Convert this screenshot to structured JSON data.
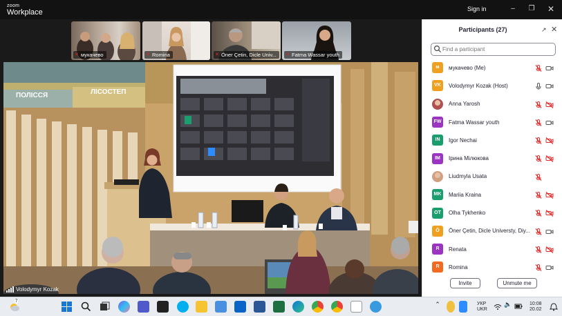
{
  "titlebar": {
    "logo_top": "zoom",
    "logo_bottom": "Workplace",
    "signin_label": "Sign in"
  },
  "thumbnails": [
    {
      "name": "мукачево"
    },
    {
      "name": "Romina"
    },
    {
      "name": "Öner Çetin, Dicle Univ..."
    },
    {
      "name": "Fatma Wassar youth"
    }
  ],
  "main_video": {
    "speaker_name": "Volodymyr Kozak",
    "wall_labels": [
      "ПОЛІССЯ",
      "ЛІСОСТЕП"
    ]
  },
  "panel": {
    "title": "Participants (27)",
    "search_placeholder": "Find a participant",
    "participants": [
      {
        "name": "мукачево (Me)",
        "initials": "м",
        "color": "#f0a020",
        "mic": "off",
        "video": "on",
        "avatar": "initials"
      },
      {
        "name": "Volodymyr Kozak (Host)",
        "initials": "VK",
        "color": "#f0a020",
        "mic": "on",
        "video": "on",
        "avatar": "initials"
      },
      {
        "name": "Anna Yarosh",
        "initials": "",
        "color": "#b05050",
        "mic": "off",
        "video": "off",
        "avatar": "photo"
      },
      {
        "name": "Fatma Wassar youth",
        "initials": "FW",
        "color": "#9b34c0",
        "mic": "off",
        "video": "on",
        "avatar": "initials"
      },
      {
        "name": "Igor Nechai",
        "initials": "IN",
        "color": "#1a9e6e",
        "mic": "off",
        "video": "off",
        "avatar": "initials"
      },
      {
        "name": "Ірина Мілюкова",
        "initials": "ІМ",
        "color": "#9b34c0",
        "mic": "off",
        "video": "off",
        "avatar": "initials"
      },
      {
        "name": "Liudmyla Usata",
        "initials": "",
        "color": "#d0a080",
        "mic": "off",
        "video": "none",
        "avatar": "photo"
      },
      {
        "name": "Mariia Kraina",
        "initials": "MK",
        "color": "#1a9e6e",
        "mic": "off",
        "video": "off",
        "avatar": "initials"
      },
      {
        "name": "Olha Tykhenko",
        "initials": "OT",
        "color": "#1a9e6e",
        "mic": "off",
        "video": "off",
        "avatar": "initials"
      },
      {
        "name": "Öner Çetin, Dicle Universty, Diy...",
        "initials": "Ö",
        "color": "#f0a020",
        "mic": "off",
        "video": "on",
        "avatar": "initials"
      },
      {
        "name": "Renata",
        "initials": "R",
        "color": "#9b34c0",
        "mic": "off",
        "video": "off",
        "avatar": "initials"
      },
      {
        "name": "Romina",
        "initials": "R",
        "color": "#f06a20",
        "mic": "off",
        "video": "on",
        "avatar": "initials"
      }
    ],
    "invite_label": "Invite",
    "unmute_label": "Unmute me"
  },
  "taskbar": {
    "weather_temp": "7",
    "lang_top": "УКР",
    "lang_bottom": "UKR",
    "time": "10:08",
    "date": "20.02"
  }
}
